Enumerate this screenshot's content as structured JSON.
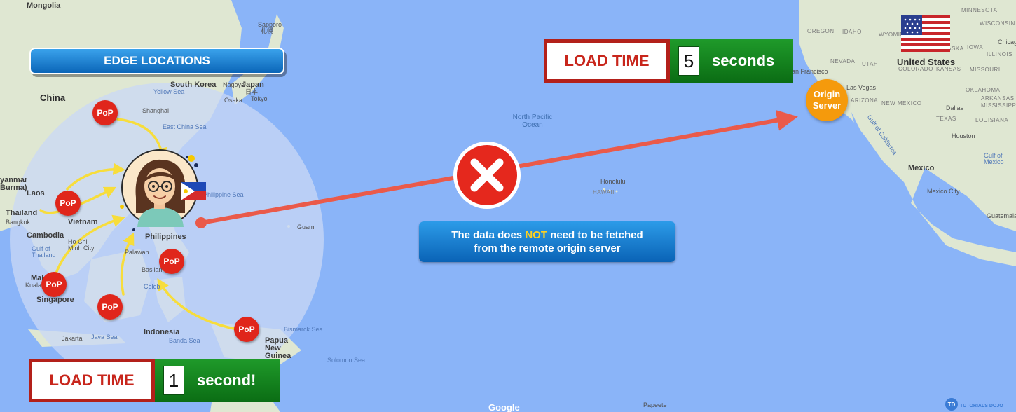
{
  "edge_title": "EDGE LOCATIONS",
  "pop_label": "PoP",
  "origin": {
    "line1": "Origin",
    "line2": "Server"
  },
  "load_top": {
    "label": "LOAD TIME",
    "number": "5",
    "unit": "seconds"
  },
  "load_bottom": {
    "label": "LOAD TIME",
    "number": "1",
    "unit": "second!"
  },
  "message": {
    "pre": "The data does ",
    "highlight": "NOT",
    "post": " need to be fetched",
    "line2": "from the remote origin server"
  },
  "map_labels": {
    "mongolia": "Mongolia",
    "china": "China",
    "south_korea": "South Korea",
    "japan": "Japan",
    "japan_native": "日本",
    "sapporo": "Sapporo",
    "sapporo_native": "札幌",
    "nagoya": "Nagoya",
    "osaka": "Osaka",
    "tokyo": "Tokyo",
    "yellow_sea": "Yellow Sea",
    "east_china_sea": "East China Sea",
    "shanghai": "Shanghai",
    "myanmar": "yanmar",
    "burma": "Burma)",
    "laos": "Laos",
    "thailand": "Thailand",
    "bangkok": "Bangkok",
    "vietnam": "Vietnam",
    "cambodia": "Cambodia",
    "ho_chi_minh": "Ho Chi Minh City",
    "gulf_thailand": "Gulf of Thailand",
    "philippines": "Philippines",
    "philippine_sea": "Philippine Sea",
    "palawan": "Palawan",
    "basilan": "Basilan",
    "malaysia": "Mal",
    "kuala": "Kuala",
    "singapore": "Singapore",
    "indonesia": "Indonesia",
    "jakarta": "Jakarta",
    "java_sea": "Java Sea",
    "banda_sea": "Banda Sea",
    "celebes": "Celeb",
    "guam": "Guam",
    "north_pacific": "North Pacific Ocean",
    "honolulu": "Honolulu",
    "hawaii": "HAWAII",
    "bismarck_sea": "Bismarck Sea",
    "papua": "Papua New Guinea",
    "solomon_sea": "Solomon Sea",
    "papeete": "Papeete",
    "san_francisco": "an Francisco",
    "las_vegas": "Las Vegas",
    "united_states": "United States",
    "mexico": "Mexico",
    "mexico_city": "Mexico City",
    "gulf_mexico": "Gulf of Mexico",
    "houston": "Houston",
    "dallas": "Dallas",
    "guatemala": "Guatemala",
    "gulf_california": "Gulf of California",
    "oregon": "OREGON",
    "idaho": "IDAHO",
    "wyoming": "WYOMIN",
    "nevada": "NEVADA",
    "utah": "UTAH",
    "colorado": "COLORADO",
    "kansas": "KANSAS",
    "missouri": "MISSOURI",
    "arizona": "ARIZONA",
    "new_mexico": "NEW MEXICO",
    "oklahoma": "OKLAHOMA",
    "texas": "TEXAS",
    "arkansas": "ARKANSAS",
    "mississippi": "MISSISSIPPI",
    "louisiana": "LOUISIANA",
    "iowa": "IOWA",
    "illinois": "ILLINOIS",
    "minnesota": "MINNESOTA",
    "wisconsin": "WISCONSIN",
    "nebraska": "NEBRASKA",
    "chicago": "Chicag",
    "google": "Google",
    "td_logo": "TUTORIALS DOJO"
  },
  "colors": {
    "ocean": "#8ab4f8",
    "land": "#dfe7d2",
    "edge_circle": "#c9d8f5",
    "pop": "#e0261b",
    "origin": "#f59a0c",
    "arrow": "#ea5a4a",
    "curve": "#f7dd3b"
  }
}
